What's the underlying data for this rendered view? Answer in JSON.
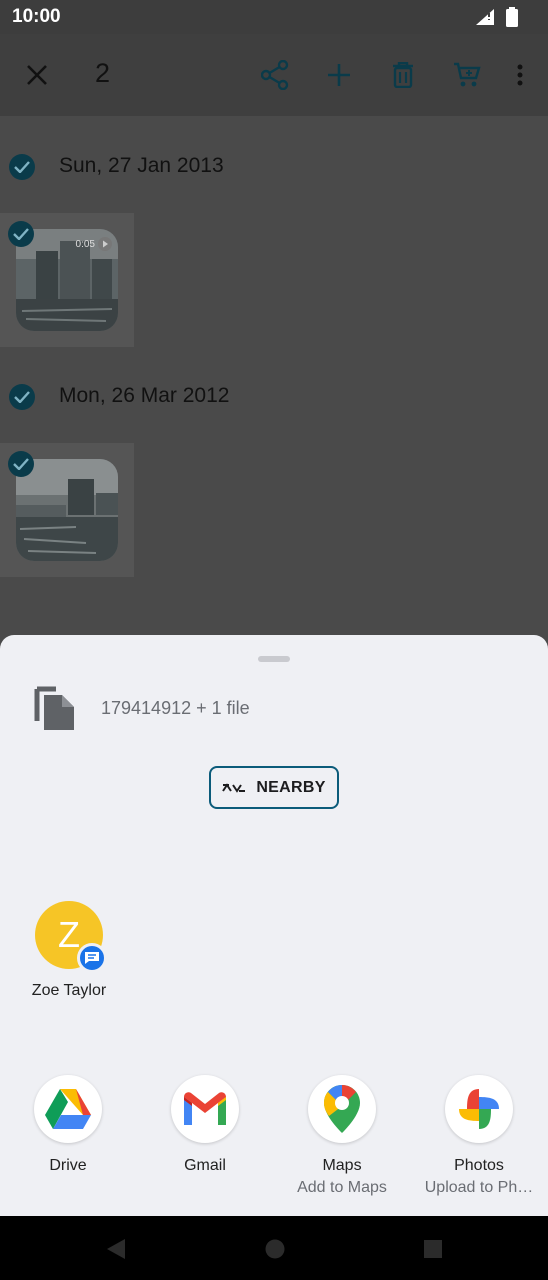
{
  "status_bar": {
    "time": "10:00"
  },
  "app_bar": {
    "selected_count": "2"
  },
  "gallery": {
    "groups": [
      {
        "date": "Sun, 27 Jan 2013",
        "is_video": true,
        "duration": "0:05"
      },
      {
        "date": "Mon, 26 Mar 2012",
        "is_video": false
      }
    ]
  },
  "share_sheet": {
    "file_summary": "179414912 + 1 file",
    "nearby_label": "NEARBY",
    "contact": {
      "initial": "Z",
      "name": "Zoe Taylor"
    },
    "apps": [
      {
        "name": "Drive",
        "sub": ""
      },
      {
        "name": "Gmail",
        "sub": ""
      },
      {
        "name": "Maps",
        "sub": "Add to Maps"
      },
      {
        "name": "Photos",
        "sub": "Upload to Ph…"
      }
    ]
  },
  "colors": {
    "accent": "#0b5b7a",
    "scrim": "#4a4a4a",
    "sheet": "#eff0f4",
    "avatar": "#f6c526"
  }
}
